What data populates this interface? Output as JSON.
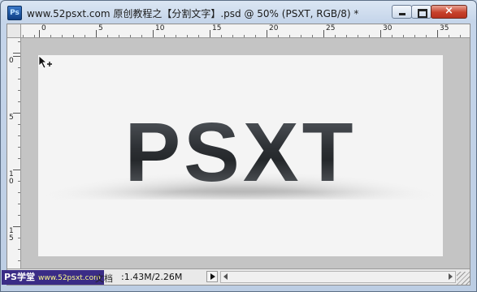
{
  "window": {
    "app_icon_label": "Ps",
    "title": "www.52psxt.com 原创教程之【分割文字】.psd @ 50% (PSXT, RGB/8) *",
    "close_label": "×"
  },
  "rulers": {
    "horizontal": [
      "0",
      "5",
      "10",
      "15",
      "20",
      "25",
      "30",
      "35"
    ],
    "vertical": [
      "0",
      "5",
      "1\n0",
      "1\n5"
    ]
  },
  "canvas": {
    "art_text": "PSXT",
    "background": "#f4f4f4",
    "text_color": "#2d3034"
  },
  "status": {
    "watermark_logo": "PS学堂",
    "watermark_url": "www.52psxt.com",
    "doc_label": "文档",
    "doc_size": ":1.43M/2.26M"
  },
  "icons": {
    "app": "photoshop-icon",
    "cursor": "move-cursor-icon",
    "minimize": "minimize-icon",
    "maximize": "maximize-icon",
    "close": "close-icon"
  }
}
